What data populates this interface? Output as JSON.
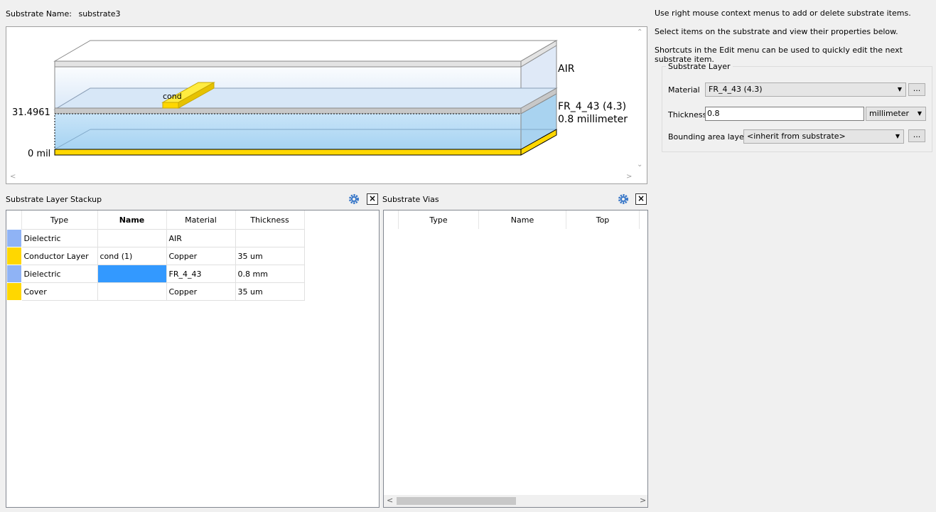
{
  "substrate": {
    "name_label": "Substrate Name:",
    "name_value": "substrate3"
  },
  "view3d": {
    "labels": {
      "air": "AIR",
      "fr4": "FR_4_43 (4.3)",
      "fr4_thickness": "0.8 millimeter",
      "height_top": "31.4961",
      "height_bottom": "0 mil",
      "cond": "cond"
    }
  },
  "stackup": {
    "title": "Substrate Layer Stackup",
    "columns": [
      "Type",
      "Name",
      "Material",
      "Thickness"
    ],
    "rows": [
      {
        "color": "#8fb3f5",
        "type": "Dielectric",
        "name": "",
        "material": "AIR",
        "thickness": ""
      },
      {
        "color": "#ffd700",
        "type": "Conductor Layer",
        "name": "cond (1)",
        "material": "Copper",
        "thickness": "35 um"
      },
      {
        "color": "#8fb3f5",
        "type": "Dielectric",
        "name": "",
        "material": "FR_4_43",
        "thickness": "0.8 mm"
      },
      {
        "color": "#ffd700",
        "type": "Cover",
        "name": "",
        "material": "Copper",
        "thickness": "35 um"
      }
    ]
  },
  "vias": {
    "title": "Substrate Vias",
    "columns": [
      "Type",
      "Name",
      "Top"
    ]
  },
  "info": {
    "line1": "Use right mouse context menus to add or delete substrate items.",
    "line2": "Select items on the substrate and view their properties below.",
    "line3": "Shortcuts in the Edit menu can be used to quickly edit the next substrate item."
  },
  "props": {
    "group_title": "Substrate Layer",
    "material_label": "Material",
    "material_value": "FR_4_43 (4.3)",
    "thickness_label": "Thickness",
    "thickness_value": "0.8",
    "thickness_unit": "millimeter",
    "bounding_label": "Bounding area layer:",
    "bounding_value": "<inherit from substrate>",
    "ellipsis": "..."
  },
  "colors": {
    "accent_selected": "#3399ff",
    "dielectric": "#8fb3f5",
    "conductor": "#ffd700"
  }
}
